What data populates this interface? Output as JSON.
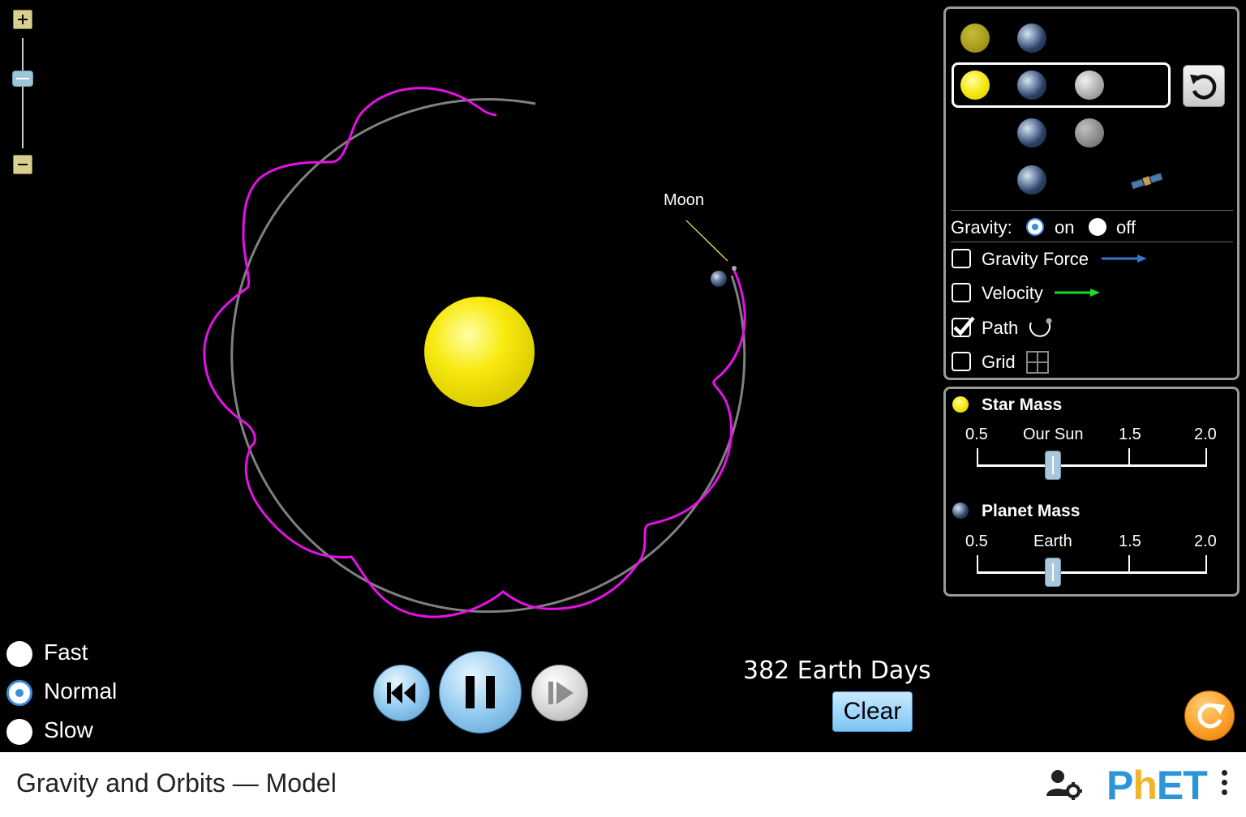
{
  "app": {
    "title": "Gravity and Orbits — Model"
  },
  "scene": {
    "moon_label": "Moon",
    "path_color": "#e611e6",
    "orbit_color": "#808080"
  },
  "control_panel": {
    "gravity": {
      "label": "Gravity:",
      "on_label": "on",
      "off_label": "off",
      "selected": "on"
    },
    "checkboxes": [
      {
        "label": "Gravity Force",
        "checked": false,
        "icon": "blue-arrow-icon"
      },
      {
        "label": "Velocity",
        "checked": false,
        "icon": "green-arrow-icon"
      },
      {
        "label": "Path",
        "checked": true,
        "icon": "path-icon"
      },
      {
        "label": "Grid",
        "checked": false,
        "icon": "grid-icon"
      }
    ],
    "accent": "#3b8de0"
  },
  "mass_panel": {
    "star": {
      "label": "Star Mass",
      "ticks": [
        "0.5",
        "Our Sun",
        "1.5",
        "2.0"
      ],
      "value": 1.0
    },
    "planet": {
      "label": "Planet Mass",
      "ticks": [
        "0.5",
        "Earth",
        "1.5",
        "2.0"
      ],
      "value": 1.0
    }
  },
  "speed": {
    "options": [
      "Fast",
      "Normal",
      "Slow"
    ],
    "selected": "Normal"
  },
  "time": {
    "elapsed": "382 Earth Days",
    "clear_label": "Clear"
  },
  "footer": {
    "logo_text_p": "P",
    "logo_text_h": "h",
    "logo_text_et": "ET"
  }
}
